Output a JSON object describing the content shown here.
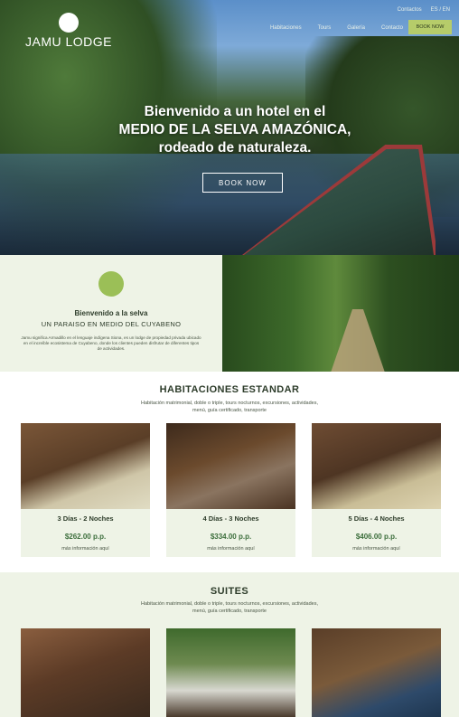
{
  "header": {
    "logo": "JAMU LODGE",
    "topbar": [
      "Contactos",
      "ES / EN"
    ],
    "nav": [
      "Habitaciones",
      "Tours",
      "Galería",
      "Contacto"
    ],
    "book_button": "BOOK NOW"
  },
  "hero": {
    "title_line1": "Bienvenido a un hotel en el",
    "title_line2": "MEDIO DE LA SELVA AMAZÓNICA,",
    "title_line3": "rodeado de naturaleza.",
    "cta": "BOOK NOW"
  },
  "welcome": {
    "title": "Bienvenido a la selva",
    "subtitle": "UN PARAISO EN MEDIO DEL CUYABENO",
    "body": "Jamu significa Armadillo en el lenguaje indígena Siona, es un lodge de propiedad privada ubicado en el increíble ecosistema de Cuyabeno, donde los clientes pueden disfrutar de diferentes tipos de actividades."
  },
  "standard": {
    "title": "HABITACIONES ESTANDAR",
    "description": "Habitación matrimonial, doble o triple, tours nocturnos, excursiones, actividades, menú, guía certificado, transporte",
    "cards": [
      {
        "title": "3 Días - 2 Noches",
        "price": "$262.00 p.p.",
        "link": "más información aquí"
      },
      {
        "title": "4 Días - 3 Noches",
        "price": "$334.00 p.p.",
        "link": "más información aquí"
      },
      {
        "title": "5 Días - 4 Noches",
        "price": "$406.00 p.p.",
        "link": "más información aquí"
      }
    ]
  },
  "suites": {
    "title": "SUITES",
    "description": "Habitación matrimonial, doble o triple, tours nocturnos, excursiones, actividades, menú, guía certificado, transporte"
  },
  "colors": {
    "accent": "#b6cc6a",
    "band": "#eef3e6",
    "price": "#3c6e3c"
  }
}
